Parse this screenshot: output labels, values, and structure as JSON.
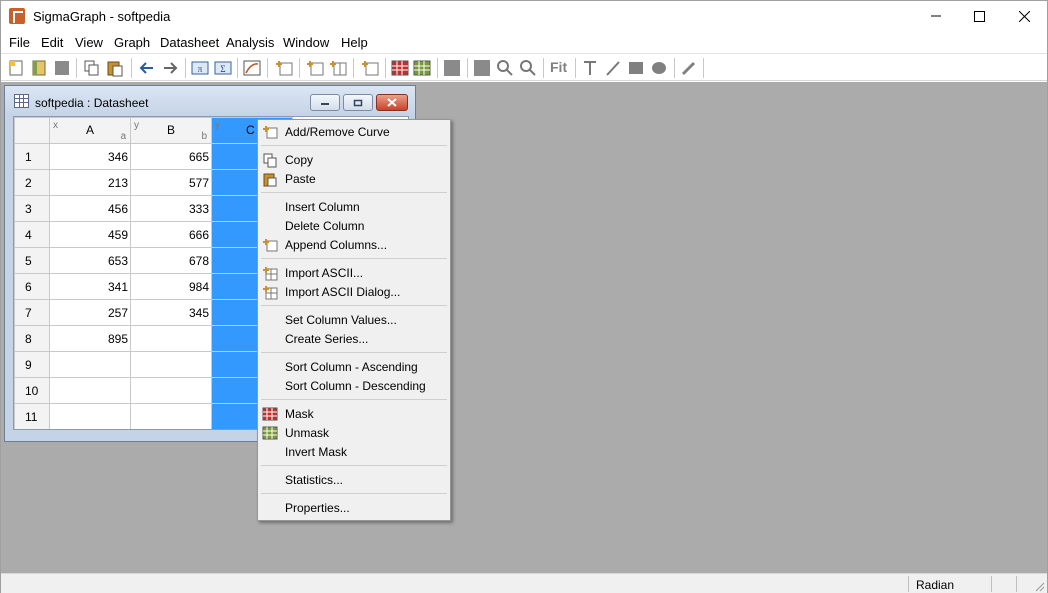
{
  "window": {
    "title": "SigmaGraph - softpedia"
  },
  "menu": {
    "items": [
      "File",
      "Edit",
      "View",
      "Graph",
      "Datasheet",
      "Analysis",
      "Window",
      "Help"
    ]
  },
  "toolbar": {
    "fit_label": "Fit"
  },
  "child": {
    "title": "softpedia : Datasheet"
  },
  "sheet": {
    "columns": [
      {
        "type": "x",
        "name": "A",
        "sub": "a"
      },
      {
        "type": "y",
        "name": "B",
        "sub": "b"
      },
      {
        "type": "y",
        "name": "C",
        "sub": ""
      }
    ],
    "rows": [
      {
        "num": "1",
        "a": "346",
        "b": "665"
      },
      {
        "num": "2",
        "a": "213",
        "b": "577"
      },
      {
        "num": "3",
        "a": "456",
        "b": "333"
      },
      {
        "num": "4",
        "a": "459",
        "b": "666"
      },
      {
        "num": "5",
        "a": "653",
        "b": "678"
      },
      {
        "num": "6",
        "a": "341",
        "b": "984"
      },
      {
        "num": "7",
        "a": "257",
        "b": "345"
      },
      {
        "num": "8",
        "a": "895",
        "b": ""
      },
      {
        "num": "9",
        "a": "",
        "b": ""
      },
      {
        "num": "10",
        "a": "",
        "b": ""
      },
      {
        "num": "11",
        "a": "",
        "b": ""
      }
    ]
  },
  "context_menu": {
    "items": [
      "Add/Remove Curve",
      "Copy",
      "Paste",
      "Insert Column",
      "Delete Column",
      "Append Columns...",
      "Import ASCII...",
      "Import ASCII Dialog...",
      "Set Column Values...",
      "Create Series...",
      "Sort Column - Ascending",
      "Sort Column - Descending",
      "Mask",
      "Unmask",
      "Invert Mask",
      "Statistics...",
      "Properties..."
    ]
  },
  "status": {
    "angle_unit": "Radian"
  },
  "colors": {
    "selection": "#3399ff",
    "workspace": "#ababab"
  }
}
